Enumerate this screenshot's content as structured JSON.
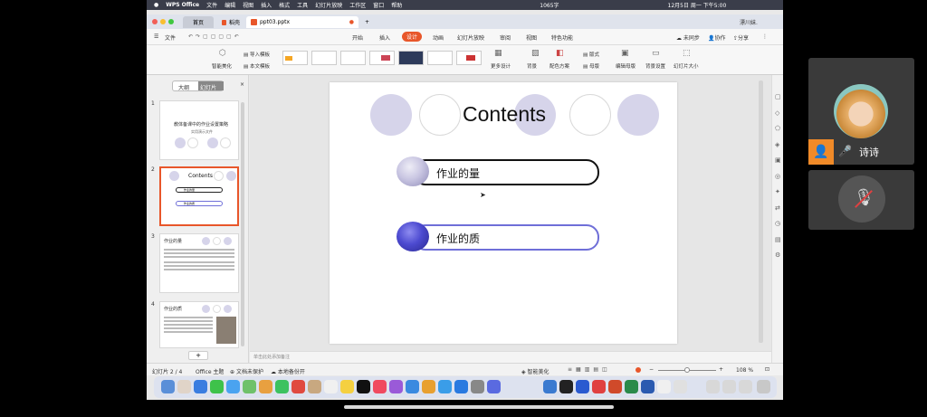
{
  "macbar": {
    "app": "WPS Office",
    "menus": [
      "文件",
      "编辑",
      "视图",
      "插入",
      "格式",
      "工具",
      "幻灯片放映",
      "工作区",
      "窗口",
      "帮助"
    ],
    "status": "1065字",
    "datetime": "12月5日 周一 下午5:00"
  },
  "tabs": {
    "home": "首页",
    "template": "稻壳",
    "doc": "ppt03.pptx",
    "user": "漂川妹."
  },
  "menu": {
    "file": "文件",
    "items": [
      "开始",
      "插入",
      "设计",
      "动画",
      "幻灯片放映",
      "审阅",
      "视图",
      "特色功能"
    ],
    "active": "设计",
    "sync": "未同步",
    "collab": "协作",
    "share": "分享"
  },
  "ribbon": {
    "beautify": "智能美化",
    "import_tpl": "导入模板",
    "local_tpl": "本文模板",
    "more": "更多设计",
    "background": "背景",
    "color_scheme": "配色方案",
    "fonts": "统一字体",
    "layout": "版式",
    "master": "母版",
    "edit_master": "编辑母版",
    "bg_settings": "背景设置",
    "slide_size": "幻灯片大小"
  },
  "leftpanel": {
    "tab_outline": "大纲",
    "tab_slides": "幻灯片",
    "slides": [
      {
        "num": "1",
        "title": "教体备课中的作业设置策略",
        "sub": "实用演示文件"
      },
      {
        "num": "2",
        "title": "Contents",
        "items": [
          "作业的量",
          "作业的质"
        ]
      },
      {
        "num": "3",
        "title": "作业的量"
      },
      {
        "num": "4",
        "title": "作业的质"
      }
    ],
    "add": "+"
  },
  "slide": {
    "title": "Contents",
    "item1": "作业的量",
    "item2": "作业的质"
  },
  "notes": {
    "placeholder": "单击此处添加备注"
  },
  "statusbar": {
    "slide_pos": "幻灯片 2 / 4",
    "theme": "Office 主题",
    "protect": "文档未保护",
    "backup": "本地备份开",
    "beautify": "智能美化",
    "zoom": "108 %"
  },
  "participant": {
    "name": "诗诗"
  },
  "colors": {
    "accent": "#e8562a",
    "circle_light": "#d6d4ea",
    "item1_border": "#111111",
    "item2_border": "#6f6fd8",
    "item2_fill": "#4c4ad0"
  }
}
